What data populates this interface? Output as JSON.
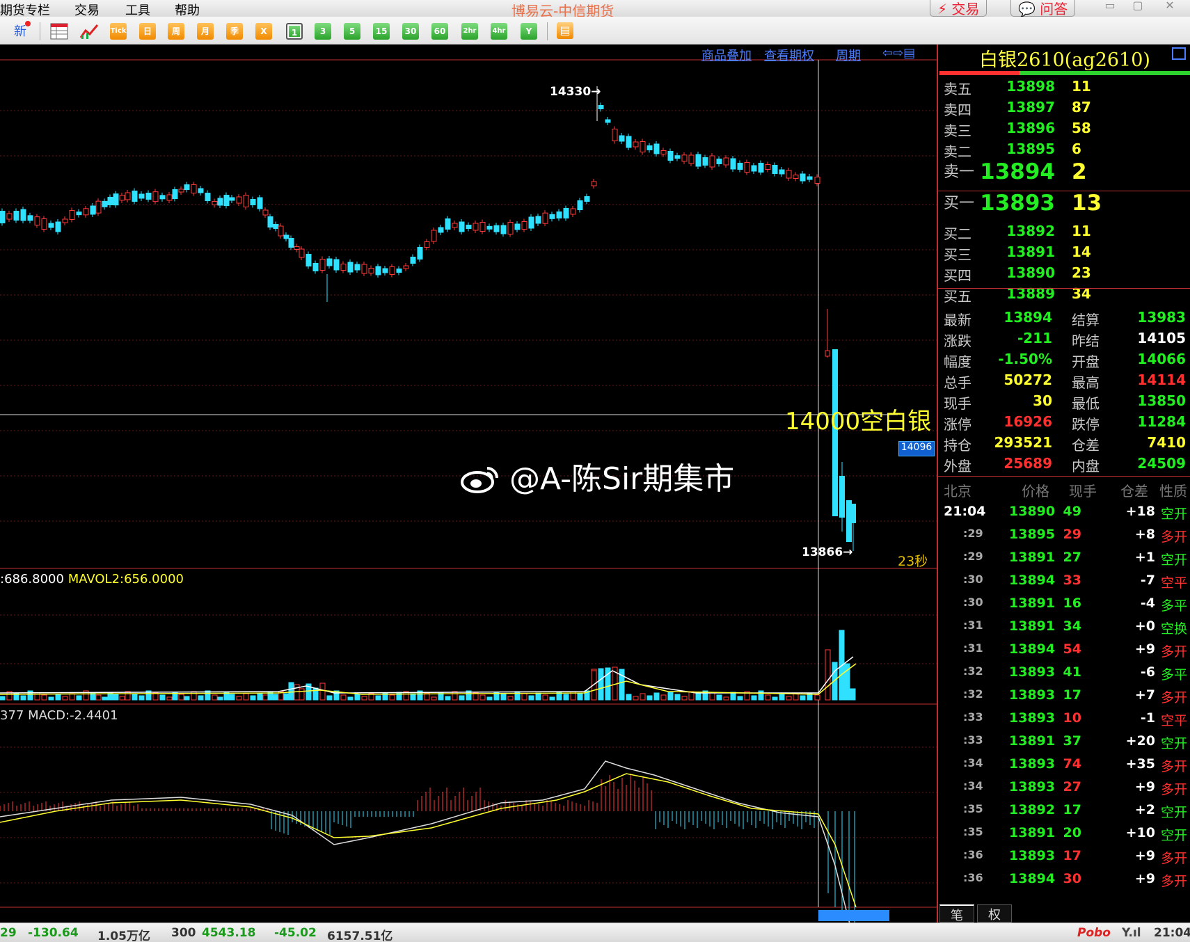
{
  "menu": {
    "items": [
      "期货专栏",
      "交易",
      "工具",
      "帮助"
    ]
  },
  "app_title": "博易云-中信期货",
  "top_buttons": {
    "trade": "⚡ 交易",
    "ask": "💬 问答"
  },
  "toolbar": {
    "new_label": "新",
    "buttons": [
      "Tick",
      "日",
      "周",
      "月",
      "季",
      "X",
      "1",
      "3",
      "5",
      "15",
      "30",
      "60",
      "2hr",
      "4hr",
      "Y"
    ],
    "selected": "1"
  },
  "chart_links": {
    "overlay": "商品叠加",
    "options": "查看期权",
    "period": "周期"
  },
  "chart": {
    "high_label": "14330→",
    "low_label": "13866→",
    "price_tag": "14096",
    "countdown": "23秒",
    "annotation": "14000空白银",
    "watermark": "@A-陈Sir期集市",
    "vol_legend_a": ":686.8000",
    "vol_legend_b": "MAVOL2:656.0000",
    "macd_legend": "377 MACD:-2.4401"
  },
  "chart_data": {
    "type": "candlestick",
    "title": "",
    "price_high": 14330,
    "price_low": 13866,
    "indicators": [
      "VOL",
      "MAVOL2",
      "MACD"
    ],
    "macd": -2.4401,
    "mavol2": 656.0
  },
  "quote": {
    "title": "白银2610(ag2610)",
    "asks": [
      {
        "label": "卖五",
        "price": "13898",
        "vol": "11"
      },
      {
        "label": "卖四",
        "price": "13897",
        "vol": "87"
      },
      {
        "label": "卖三",
        "price": "13896",
        "vol": "58"
      },
      {
        "label": "卖二",
        "price": "13895",
        "vol": "6"
      },
      {
        "label": "卖一",
        "price": "13894",
        "vol": "2"
      }
    ],
    "bids": [
      {
        "label": "买一",
        "price": "13893",
        "vol": "13"
      },
      {
        "label": "买二",
        "price": "13892",
        "vol": "11"
      },
      {
        "label": "买三",
        "price": "13891",
        "vol": "14"
      },
      {
        "label": "买四",
        "price": "13890",
        "vol": "23"
      },
      {
        "label": "买五",
        "price": "13889",
        "vol": "34"
      }
    ],
    "stats": [
      {
        "l1": "最新",
        "v1": "13894",
        "c1": "#22ee22",
        "l2": "结算",
        "v2": "13983",
        "c2": "#22ee22"
      },
      {
        "l1": "涨跌",
        "v1": "-211",
        "c1": "#22ee22",
        "l2": "昨结",
        "v2": "14105",
        "c2": "#ffffff"
      },
      {
        "l1": "幅度",
        "v1": "-1.50%",
        "c1": "#22ee22",
        "l2": "开盘",
        "v2": "14066",
        "c2": "#22ee22"
      },
      {
        "l1": "总手",
        "v1": "50272",
        "c1": "#ffff30",
        "l2": "最高",
        "v2": "14114",
        "c2": "#ff3030"
      },
      {
        "l1": "现手",
        "v1": "30",
        "c1": "#ffff30",
        "l2": "最低",
        "v2": "13850",
        "c2": "#22ee22"
      },
      {
        "l1": "涨停",
        "v1": "16926",
        "c1": "#ff3030",
        "l2": "跌停",
        "v2": "11284",
        "c2": "#22ee22"
      },
      {
        "l1": "持仓",
        "v1": "293521",
        "c1": "#ffff30",
        "l2": "仓差",
        "v2": "7410",
        "c2": "#ffff30"
      },
      {
        "l1": "外盘",
        "v1": "25689",
        "c1": "#ff3030",
        "l2": "内盘",
        "v2": "24509",
        "c2": "#22ee22"
      }
    ]
  },
  "ticks": {
    "headers": [
      "北京",
      "价格",
      "现手",
      "仓差",
      "性质"
    ],
    "rows": [
      {
        "t": "21:04",
        "p": "13890",
        "q": "49",
        "qc": "#22ee22",
        "d": "+18",
        "n": "空开",
        "nc": "#22ee22"
      },
      {
        "t": ":29",
        "p": "13895",
        "q": "29",
        "qc": "#ff3030",
        "d": "+8",
        "n": "多开",
        "nc": "#ff3030"
      },
      {
        "t": ":29",
        "p": "13891",
        "q": "27",
        "qc": "#22ee22",
        "d": "+1",
        "n": "空开",
        "nc": "#22ee22"
      },
      {
        "t": ":30",
        "p": "13894",
        "q": "33",
        "qc": "#ff3030",
        "d": "-7",
        "n": "空平",
        "nc": "#ff3030"
      },
      {
        "t": ":30",
        "p": "13891",
        "q": "16",
        "qc": "#22ee22",
        "d": "-4",
        "n": "多平",
        "nc": "#22ee22"
      },
      {
        "t": ":31",
        "p": "13891",
        "q": "34",
        "qc": "#22ee22",
        "d": "+0",
        "n": "空换",
        "nc": "#22ee22"
      },
      {
        "t": ":31",
        "p": "13894",
        "q": "54",
        "qc": "#ff3030",
        "d": "+9",
        "n": "多开",
        "nc": "#ff3030"
      },
      {
        "t": ":32",
        "p": "13893",
        "q": "41",
        "qc": "#22ee22",
        "d": "-6",
        "n": "多平",
        "nc": "#22ee22"
      },
      {
        "t": ":32",
        "p": "13893",
        "q": "17",
        "qc": "#22ee22",
        "d": "+7",
        "n": "多开",
        "nc": "#ff3030"
      },
      {
        "t": ":33",
        "p": "13893",
        "q": "10",
        "qc": "#ff3030",
        "d": "-1",
        "n": "空平",
        "nc": "#ff3030"
      },
      {
        "t": ":33",
        "p": "13891",
        "q": "37",
        "qc": "#22ee22",
        "d": "+20",
        "n": "空开",
        "nc": "#22ee22"
      },
      {
        "t": ":34",
        "p": "13893",
        "q": "74",
        "qc": "#ff3030",
        "d": "+35",
        "n": "多开",
        "nc": "#ff3030"
      },
      {
        "t": ":34",
        "p": "13893",
        "q": "27",
        "qc": "#ff3030",
        "d": "+9",
        "n": "多开",
        "nc": "#ff3030"
      },
      {
        "t": ":35",
        "p": "13892",
        "q": "17",
        "qc": "#22ee22",
        "d": "+2",
        "n": "空开",
        "nc": "#22ee22"
      },
      {
        "t": ":35",
        "p": "13891",
        "q": "20",
        "qc": "#22ee22",
        "d": "+10",
        "n": "空开",
        "nc": "#22ee22"
      },
      {
        "t": ":36",
        "p": "13893",
        "q": "17",
        "qc": "#ff3030",
        "d": "+9",
        "n": "多开",
        "nc": "#ff3030"
      },
      {
        "t": ":36",
        "p": "13894",
        "q": "30",
        "qc": "#ff3030",
        "d": "+9",
        "n": "多开",
        "nc": "#ff3030"
      }
    ],
    "tabs": [
      "笔",
      "权"
    ]
  },
  "status_bar": {
    "s1": "29",
    "s2": "-130.64",
    "s3": "1.05万亿",
    "s4": "300",
    "s5": "4543.18",
    "s6": "-45.02",
    "s7": "6157.51亿",
    "brand": "Pobo",
    "signal": "Y.ıl",
    "time": "21:04"
  }
}
